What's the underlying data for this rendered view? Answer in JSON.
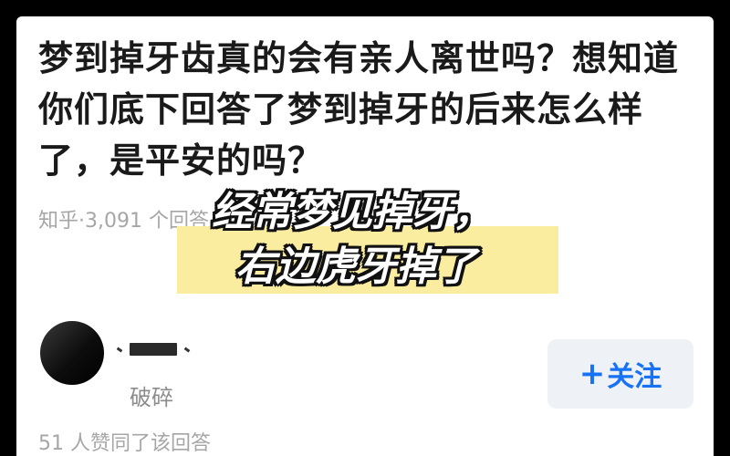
{
  "question": {
    "title": "梦到掉牙齿真的会有亲人离世吗？想知道你们底下回答了梦到掉牙的后来怎么样了，是平安的吗？",
    "meta": "知乎·3,091 个回答"
  },
  "answer": {
    "author_bio": "破碎",
    "follow_plus": "+",
    "follow_label": "关注",
    "vote_text": "51 人赞同了该回答"
  },
  "caption": {
    "line1": "经常梦见掉牙，",
    "line2": "右边虎牙掉了",
    "highlight_color": "#fbeda0"
  },
  "colors": {
    "accent": "#1772f6",
    "muted_text": "#a6a6a6",
    "title_text": "#1a1a1a"
  }
}
